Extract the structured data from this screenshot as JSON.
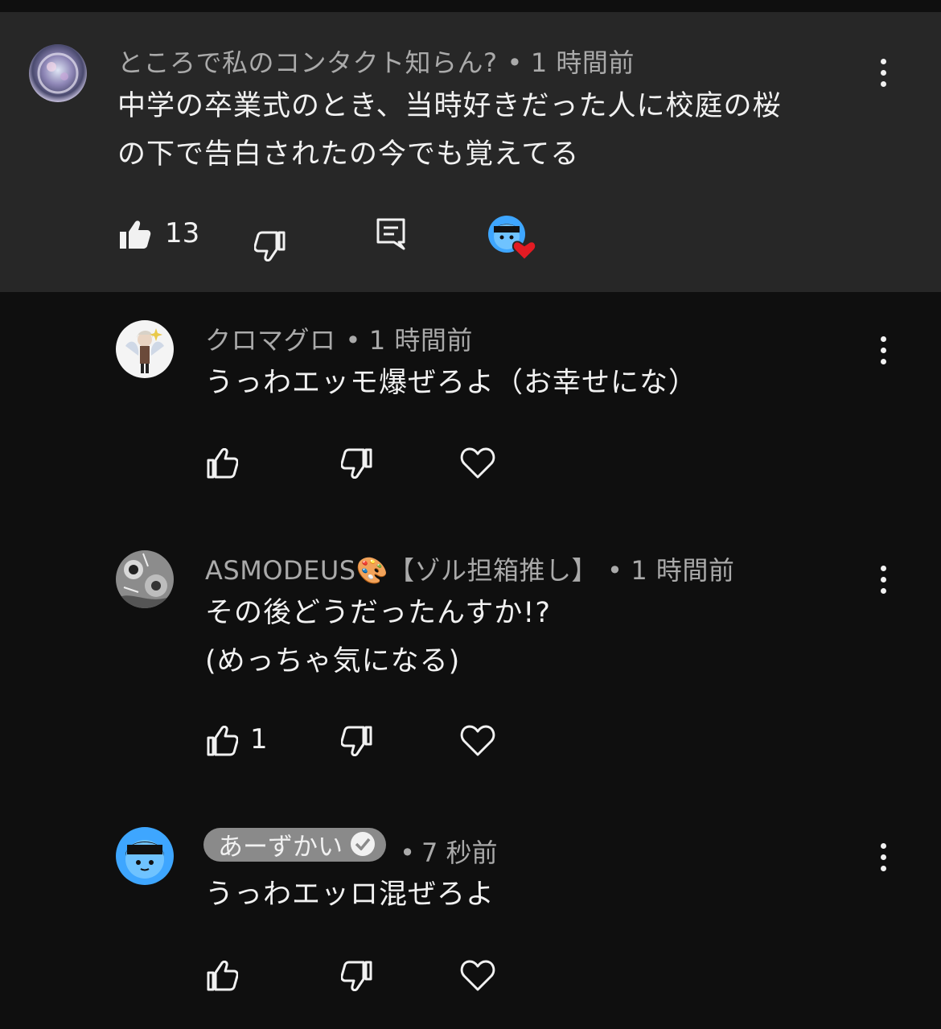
{
  "comments": [
    {
      "author": "ところで私のコンタクト知らん?",
      "separator": "•",
      "time": "1 時間前",
      "text": "中学の卒業式のとき、当時好きだった人に校庭の桜\nの下で告白されたの今でも覚えてる",
      "likes": "13",
      "liked": true,
      "creator_heart": true
    },
    {
      "author": "クロマグロ",
      "separator": "•",
      "time": "1 時間前",
      "text": "うっわエッモ爆ぜろよ（お幸せにな）",
      "likes": ""
    },
    {
      "author": "ASMODEUS🎨【ゾル担箱推し】",
      "separator": "•",
      "time": "1 時間前",
      "text": "その後どうだったんすか!?\n(めっちゃ気になる)",
      "likes": "1"
    },
    {
      "author": "あーずかい",
      "verified": true,
      "separator": "•",
      "time": "7 秒前",
      "text": "うっわエッロ混ぜろよ",
      "likes": ""
    }
  ],
  "colors": {
    "background": "#0f0f0f",
    "highlight": "#272727",
    "meta_text": "#aaaaaa",
    "text": "#f1f1f1",
    "heart": "#e31b23",
    "chip": "#8a8a8a",
    "blue_avatar": "#3ea6ff"
  },
  "icons": [
    "like-icon",
    "dislike-icon",
    "reply-icon",
    "heart-icon",
    "more-icon",
    "verified-icon"
  ]
}
